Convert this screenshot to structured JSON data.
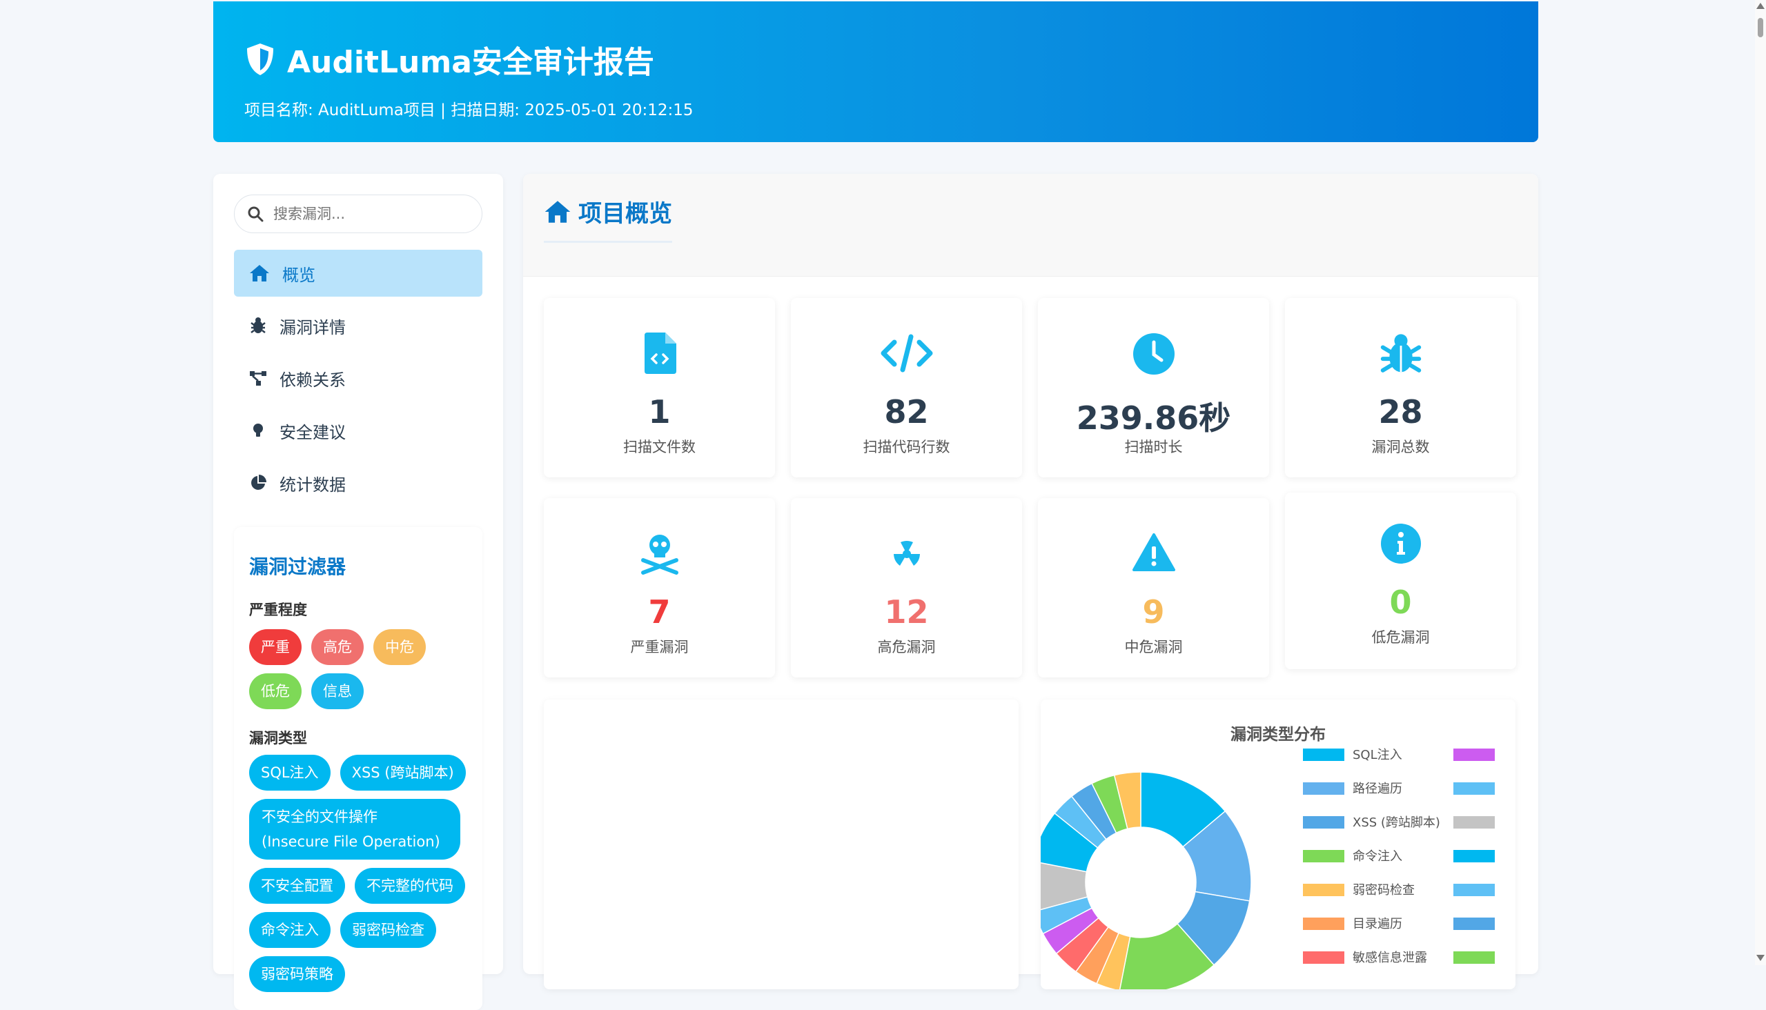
{
  "header": {
    "title": "AuditLuma安全审计报告",
    "subtitle": "项目名称: AuditLuma项目 | 扫描日期: 2025-05-01 20:12:15"
  },
  "sidebar": {
    "search_placeholder": "搜索漏洞...",
    "nav": [
      {
        "label": "概览",
        "icon": "home-icon"
      },
      {
        "label": "漏洞详情",
        "icon": "bug-icon"
      },
      {
        "label": "依赖关系",
        "icon": "graph-icon"
      },
      {
        "label": "安全建议",
        "icon": "lightbulb-icon"
      },
      {
        "label": "统计数据",
        "icon": "pie-chart-icon"
      }
    ],
    "filter": {
      "title": "漏洞过滤器",
      "severity_label": "严重程度",
      "severity": [
        {
          "label": "严重",
          "color": "#f03c3c"
        },
        {
          "label": "高危",
          "color": "#f0706e"
        },
        {
          "label": "中危",
          "color": "#f7bb5c"
        },
        {
          "label": "低危",
          "color": "#7ed957"
        },
        {
          "label": "信息",
          "color": "#1ab8ee"
        }
      ],
      "type_label": "漏洞类型",
      "types": [
        "SQL注入",
        "XSS (跨站脚本)",
        "不安全的文件操作 (Insecure File Operation)",
        "不安全配置",
        "不完整的代码",
        "命令注入",
        "弱密码检查",
        "弱密码策略"
      ]
    }
  },
  "main": {
    "title": "项目概览",
    "stats": [
      {
        "value": "1",
        "label": "扫描文件数",
        "icon": "file-code-icon",
        "color": "#1ab8ee"
      },
      {
        "value": "82",
        "label": "扫描代码行数",
        "icon": "code-icon",
        "color": "#1ab8ee"
      },
      {
        "value": "239.86秒",
        "label": "扫描时长",
        "icon": "clock-icon",
        "color": "#1ab8ee"
      },
      {
        "value": "28",
        "label": "漏洞总数",
        "icon": "bug-icon",
        "color": "#1ab8ee"
      }
    ],
    "severity_stats": [
      {
        "value": "7",
        "label": "严重漏洞",
        "icon": "skull-crossbones-icon",
        "color": "#f03c3c"
      },
      {
        "value": "12",
        "label": "高危漏洞",
        "icon": "radiation-icon",
        "color": "#f0706e"
      },
      {
        "value": "9",
        "label": "中危漏洞",
        "icon": "warning-icon",
        "color": "#f7bb5c"
      },
      {
        "value": "0",
        "label": "低危漏洞",
        "icon": "info-icon",
        "color": "#7ed957"
      }
    ]
  },
  "chart_data": {
    "type": "pie",
    "title": "漏洞类型分布",
    "legend": [
      {
        "name": "SQL注入",
        "color": "#00b8f0"
      },
      {
        "name": "路径遍历",
        "color": "#63b1ee"
      },
      {
        "name": "XSS (跨站脚本)",
        "color": "#52a7e6"
      },
      {
        "name": "命令注入",
        "color": "#7ed957"
      },
      {
        "name": "弱密码检查",
        "color": "#ffc35c"
      },
      {
        "name": "目录遍历",
        "color": "#ffa05c"
      },
      {
        "name": "敏感信息泄露",
        "color": "#ff6b6b"
      }
    ],
    "legend_col2_colors": [
      "#cc5cf0",
      "#5ec0f5",
      "#c4c4c4",
      "#00b8f0",
      "#5ec0f5",
      "#52a7e6",
      "#7ed957"
    ],
    "slices": [
      {
        "color": "#00b8f0",
        "value": 3.6
      },
      {
        "color": "#63b1ee",
        "value": 3.6
      },
      {
        "color": "#52a7e6",
        "value": 2.8
      },
      {
        "color": "#7ed957",
        "value": 3.8
      },
      {
        "color": "#ffc35c",
        "value": 0.9
      },
      {
        "color": "#ffa05c",
        "value": 0.9
      },
      {
        "color": "#ff6b6b",
        "value": 1.0
      },
      {
        "color": "#cc5cf0",
        "value": 0.9
      },
      {
        "color": "#5ec0f5",
        "value": 0.9
      },
      {
        "color": "#c4c4c4",
        "value": 1.9
      },
      {
        "color": "#00b8f0",
        "value": 2.0
      },
      {
        "color": "#5ec0f5",
        "value": 0.9
      },
      {
        "color": "#52a7e6",
        "value": 0.9
      },
      {
        "color": "#7ed957",
        "value": 0.9
      },
      {
        "color": "#ffc35c",
        "value": 1.0
      }
    ]
  }
}
